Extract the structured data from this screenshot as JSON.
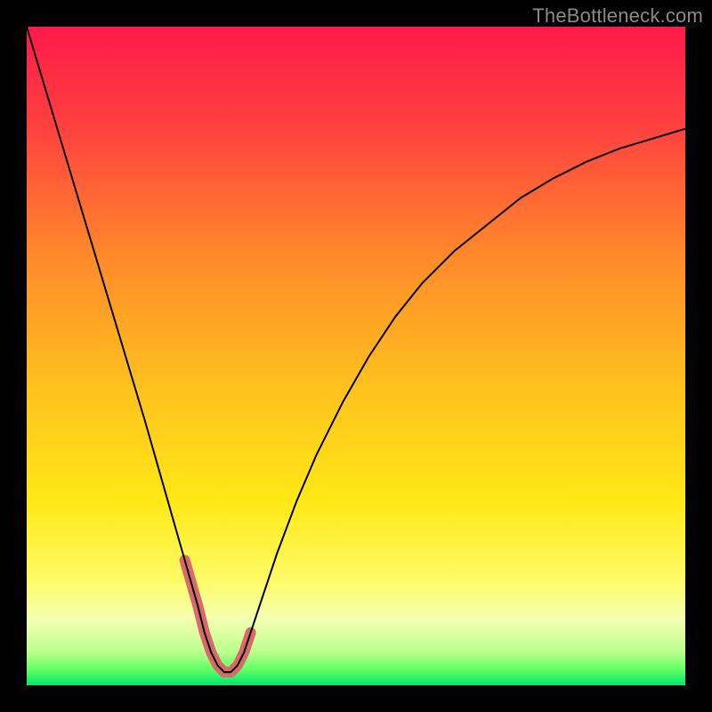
{
  "watermark": "TheBottleneck.com",
  "chart_data": {
    "type": "line",
    "title": "",
    "xlabel": "",
    "ylabel": "",
    "xlim": [
      0,
      100
    ],
    "ylim": [
      0,
      100
    ],
    "grid": false,
    "legend": false,
    "background_gradient": {
      "stops": [
        {
          "offset": 0.0,
          "color": "#ff1a4b"
        },
        {
          "offset": 0.15,
          "color": "#ff4040"
        },
        {
          "offset": 0.35,
          "color": "#ff8a2a"
        },
        {
          "offset": 0.55,
          "color": "#ffc21e"
        },
        {
          "offset": 0.72,
          "color": "#ffe815"
        },
        {
          "offset": 0.84,
          "color": "#fffb66"
        },
        {
          "offset": 0.9,
          "color": "#f4ffb0"
        },
        {
          "offset": 0.95,
          "color": "#b9ff8c"
        },
        {
          "offset": 0.975,
          "color": "#66ff66"
        },
        {
          "offset": 1.0,
          "color": "#00e868"
        }
      ]
    },
    "series": [
      {
        "name": "bottleneck-curve",
        "color": "#000000",
        "width": 2,
        "x": [
          0,
          3,
          6,
          9,
          12,
          15,
          18,
          20,
          22,
          24,
          26,
          27,
          28,
          29,
          30,
          31,
          32,
          33,
          34,
          36,
          38,
          41,
          44,
          48,
          52,
          56,
          60,
          65,
          70,
          75,
          80,
          85,
          90,
          95,
          100
        ],
        "values": [
          100,
          90,
          80,
          70,
          60,
          50,
          40,
          33,
          26,
          19,
          12,
          8,
          5,
          3,
          2,
          2,
          3,
          5,
          8,
          14,
          20,
          28,
          35,
          43,
          50,
          56,
          61,
          66,
          70,
          74,
          77,
          79.5,
          81.5,
          83,
          84.5
        ]
      },
      {
        "name": "highlight-bottom",
        "color": "#d96a6a",
        "width": 12,
        "linecap": "round",
        "x": [
          24,
          26,
          27,
          28,
          29,
          30,
          31,
          32,
          33,
          34
        ],
        "values": [
          19,
          12,
          8,
          5,
          3,
          2,
          2,
          3,
          5,
          8
        ]
      }
    ]
  }
}
